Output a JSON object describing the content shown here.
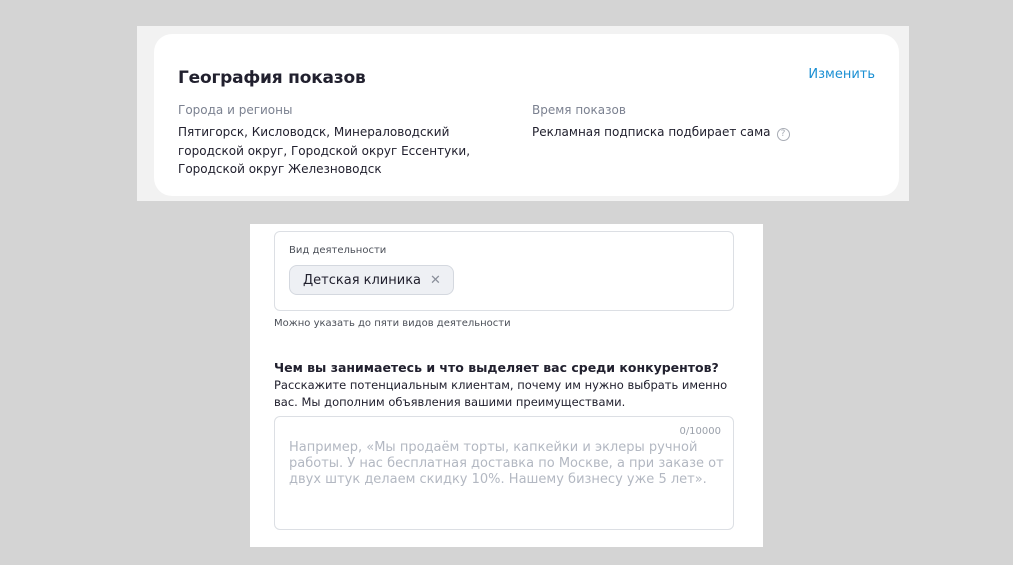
{
  "geography": {
    "title": "География показов",
    "edit_link": "Изменить",
    "regions_label": "Города и регионы",
    "regions_value": "Пятигорск, Кисловодск, Минераловодский городской округ, Городской округ Ессентуки, Городской округ Железноводск",
    "time_label": "Время показов",
    "time_value": "Рекламная подписка подбирает сама",
    "help_icon": "question-circle-icon"
  },
  "form": {
    "activity_label": "Вид деятельности",
    "activity_chip": "Детская клиника",
    "chip_close_icon": "close-icon",
    "activity_hint": "Можно указать до пяти видов деятельности",
    "question_title": "Чем вы занимаетесь и что выделяет вас среди конкурентов?",
    "question_desc": "Расскажите потенциальным клиентам, почему им нужно выбрать именно вас. Мы дополним объявления вашими преимуществами.",
    "char_counter": "0/10000",
    "textarea_placeholder": "Например, «Мы продаём торты, капкейки и эклеры ручной работы. У нас бесплатная доставка по Москве, а при заказе от двух штук делаем скидку 10%. Нашему бизнесу уже 5 лет»."
  },
  "colors": {
    "background": "#d4d4d4",
    "link": "#1a8fd3",
    "text": "#21202e",
    "muted": "#7b8190"
  }
}
